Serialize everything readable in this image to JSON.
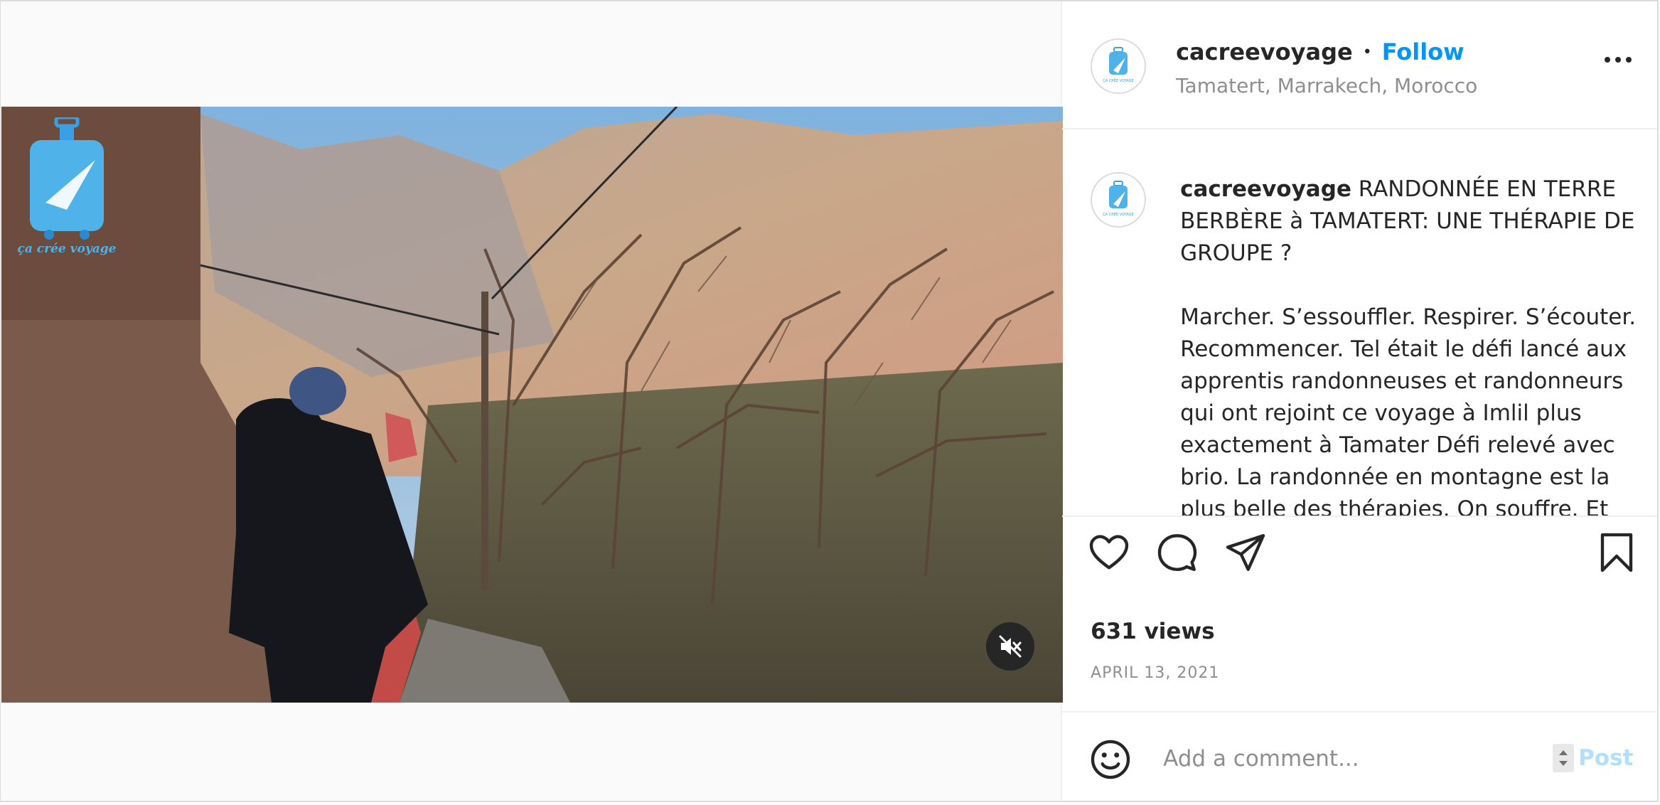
{
  "post": {
    "username": "cacreevoyage",
    "separator": "•",
    "follow_label": "Follow",
    "location": "Tamatert, Marrakech, Morocco",
    "avatar_text": "ÇA CRÉE VOYAGE",
    "watermark_text": "ça crée voyage",
    "caption": {
      "username": "cacreevoyage",
      "text": " RANDONNÉE EN TERRE BERBÈRE à TAMATERT: UNE THÉRAPIE DE GROUPE ?\n\nMarcher. S’essouffler. Respirer. S’écouter. Recommencer. Tel était le défi lancé aux apprentis randonneuses et randonneurs qui ont rejoint ce voyage à Imlil plus exactement à Tamater Défi relevé avec brio. La randonnée en montagne est la plus belle des thérapies. On souffre. Et"
    },
    "views": "631 views",
    "date": "APRIL 13, 2021",
    "comment": {
      "placeholder": "Add a comment...",
      "value": "",
      "post_label": "Post"
    },
    "video": {
      "muted": true
    }
  },
  "icons": {
    "more": "more-options-icon",
    "like": "heart-icon",
    "comment": "comment-icon",
    "share": "share-icon",
    "save": "bookmark-icon",
    "emoji": "emoji-icon",
    "mute": "speaker-muted-icon"
  },
  "colors": {
    "accent": "#0095f6",
    "post_disabled": "#b2dffc",
    "secondary_text": "#8e8e8e",
    "text": "#262626"
  }
}
